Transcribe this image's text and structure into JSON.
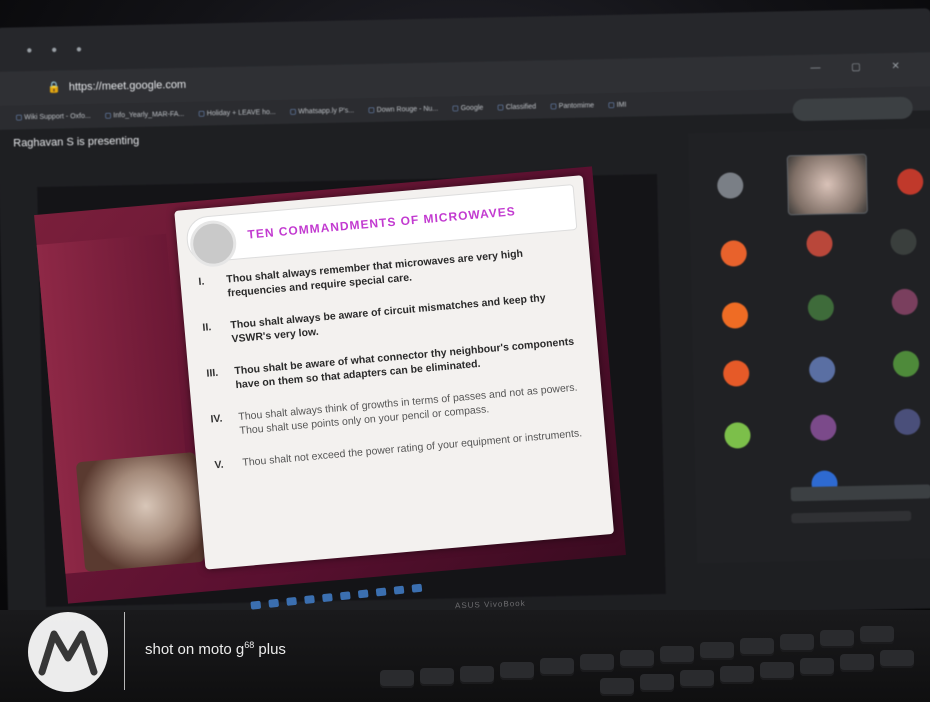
{
  "browser": {
    "url": "https://meet.google.com",
    "bookmarks": [
      "Wiki Support - Oxfo...",
      "Info_Yearly_MAR-FA...",
      "Holiday + LEAVE ho...",
      "Whatsapp.ly P's...",
      "Down Rouge - Nu...",
      "Google",
      "Classified",
      "Pantomime",
      "IMI"
    ]
  },
  "meet": {
    "presenting_text": "Raghavan S is presenting"
  },
  "slide": {
    "title": "TEN COMMANDMENTS OF MICROWAVES",
    "commandments": [
      {
        "num": "I.",
        "text": "Thou shalt always remember that microwaves are very high frequencies and require special care."
      },
      {
        "num": "II.",
        "text": "Thou shalt always be aware of circuit mismatches and keep thy VSWR's very low."
      },
      {
        "num": "III.",
        "text": "Thou shalt be aware of what connector thy neighbour's components have on them so that adapters can be eliminated."
      },
      {
        "num": "IV.",
        "text": "Thou shalt always think of growths in terms of passes and not as powers. Thou shalt use points only on your pencil or compass."
      },
      {
        "num": "V.",
        "text": "Thou shalt not exceed the power rating of your equipment or instruments."
      }
    ]
  },
  "laptop": {
    "brand": "ASUS VivoBook"
  },
  "watermark": {
    "text_main": "shot on moto g",
    "text_sup": "68",
    "text_tail": " plus",
    "logo": "motorola-logo"
  },
  "colors": {
    "slide_title": "#c23ad0",
    "slide_bg": "#f3f1ef",
    "maroon": "#7a1f3b",
    "meet_panel": "#202124"
  }
}
